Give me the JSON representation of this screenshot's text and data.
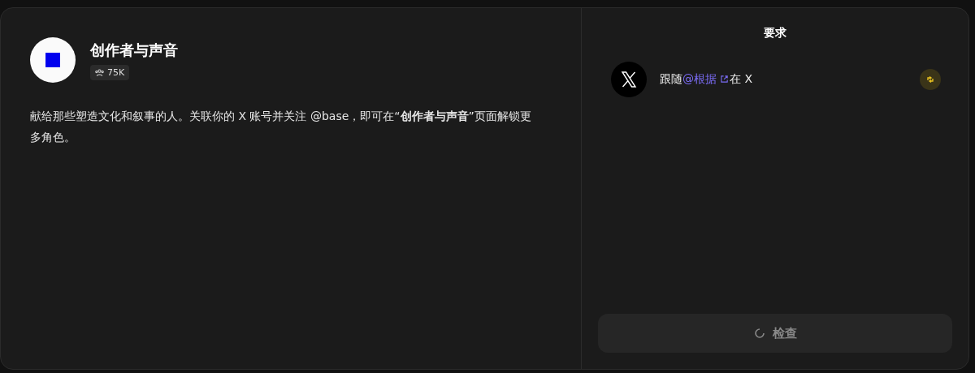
{
  "community": {
    "title": "创作者与声音",
    "members": "75K",
    "description": "献给那些塑造文化和叙事的人。关联你的 X 账号并关注 @base，即可在“**创作者与声音**”页面解锁更多角色。"
  },
  "requirements": {
    "title": "要求",
    "items": [
      {
        "prefix": "跟随",
        "link": "@根据",
        "suffix": "在 X"
      }
    ]
  },
  "check_button": {
    "label": "检查",
    "disabled": true
  }
}
